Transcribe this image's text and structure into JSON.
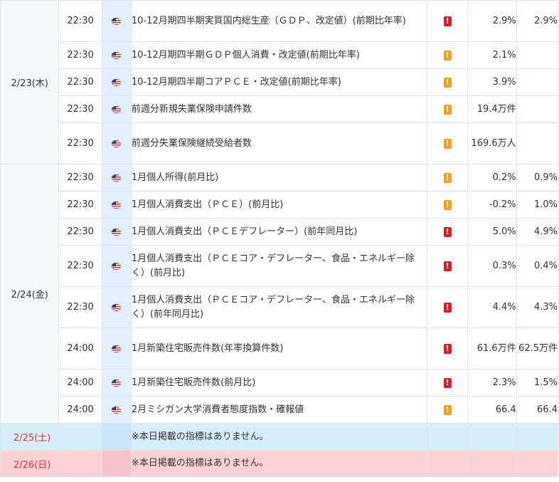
{
  "colors": {
    "importance_high": "#e0192a",
    "importance_mid": "#f5a21b",
    "saturday_row": "#d6eef8",
    "sunday_row": "#fcd1d6",
    "weekend_date_text": "#d9343f"
  },
  "country_icon": "us-flag-icon",
  "days": [
    {
      "date": "2/23(木)",
      "rows": [
        {
          "time": "22:30",
          "name": "10-12月期四半期実質国内総生産（ＧＤＰ、改定値）(前期比年率)",
          "importance": "high",
          "prev": "2.9%",
          "fcst": "2.9%"
        },
        {
          "time": "22:30",
          "name": "10-12月期四半期ＧＤＰ個人消費・改定値(前期比年率)",
          "importance": "mid",
          "prev": "2.1%",
          "fcst": ""
        },
        {
          "time": "22:30",
          "name": "10-12月期四半期コアＰＣＥ・改定値(前期比年率)",
          "importance": "mid",
          "prev": "3.9%",
          "fcst": ""
        },
        {
          "time": "22:30",
          "name": "前週分新規失業保険申請件数",
          "importance": "mid",
          "prev": "19.4万件",
          "fcst": ""
        },
        {
          "time": "22:30",
          "name": "前週分失業保険継続受給者数",
          "importance": "mid",
          "prev": "169.6万人",
          "fcst": ""
        }
      ]
    },
    {
      "date": "2/24(金)",
      "rows": [
        {
          "time": "22:30",
          "name": "1月個人所得(前月比)",
          "importance": "mid",
          "prev": "0.2%",
          "fcst": "0.9%"
        },
        {
          "time": "22:30",
          "name": "1月個人消費支出（ＰＣＥ）(前月比)",
          "importance": "mid",
          "prev": "-0.2%",
          "fcst": "1.0%"
        },
        {
          "time": "22:30",
          "name": "1月個人消費支出（ＰＣＥデフレーター）(前年同月比)",
          "importance": "high",
          "prev": "5.0%",
          "fcst": "4.9%"
        },
        {
          "time": "22:30",
          "name": "1月個人消費支出（ＰＣＥコア・デフレーター、食品・エネルギー除く）(前月比)",
          "importance": "high",
          "prev": "0.3%",
          "fcst": "0.4%"
        },
        {
          "time": "22:30",
          "name": "1月個人消費支出（ＰＣＥコア・デフレーター、食品・エネルギー除く）(前年同月比)",
          "importance": "high",
          "prev": "4.4%",
          "fcst": "4.3%"
        },
        {
          "time": "24:00",
          "name": "1月新築住宅販売件数(年率換算件数)",
          "importance": "high",
          "prev": "61.6万件",
          "fcst": "62.5万件"
        },
        {
          "time": "24:00",
          "name": "1月新築住宅販売件数(前月比)",
          "importance": "high",
          "prev": "2.3%",
          "fcst": "1.5%"
        },
        {
          "time": "24:00",
          "name": "2月ミシガン大学消費者態度指数・確報値",
          "importance": "mid",
          "prev": "66.4",
          "fcst": "66.4"
        }
      ]
    }
  ],
  "weekend": [
    {
      "date": "2/25(土)",
      "note": "※本日掲載の指標はありません。",
      "kind": "sat"
    },
    {
      "date": "2/26(日)",
      "note": "※本日掲載の指標はありません。",
      "kind": "sun"
    }
  ]
}
